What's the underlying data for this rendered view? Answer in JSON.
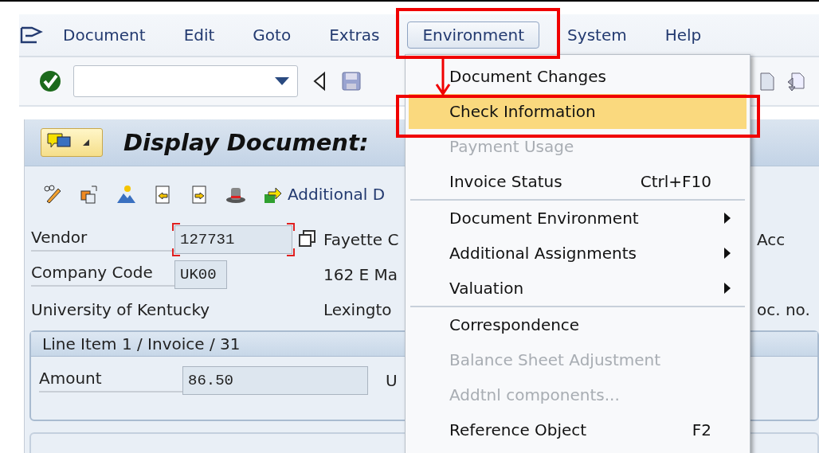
{
  "menu_bar": [
    {
      "label": "Document",
      "selected": false
    },
    {
      "label": "Edit",
      "selected": false
    },
    {
      "label": "Goto",
      "selected": false
    },
    {
      "label": "Extras",
      "selected": false
    },
    {
      "label": "Environment",
      "selected": true
    },
    {
      "label": "System",
      "selected": false
    },
    {
      "label": "Help",
      "selected": false
    }
  ],
  "title": "Display Document:",
  "app_toolbar": {
    "link": "Additional D"
  },
  "form": [
    {
      "kind": "field",
      "label": "Vendor",
      "value": "127731",
      "middle": "Fayette C",
      "right": "Acc"
    },
    {
      "kind": "field",
      "label": "Company Code",
      "value": "UK00",
      "middle": "162 E Ma"
    },
    {
      "kind": "text",
      "label": "University of Kentucky",
      "middle": "Lexingto",
      "right": "oc. no."
    }
  ],
  "line_item": {
    "title": "Line Item 1 / Invoice / 31",
    "label": "Amount",
    "value": "86.50",
    "unit": "U"
  },
  "dropdown": {
    "groups": [
      {
        "items": [
          {
            "label": "Document Changes",
            "selected": false,
            "disabled": false,
            "submenu": false
          },
          {
            "label": "Check Information",
            "selected": true,
            "disabled": false,
            "submenu": false
          },
          {
            "label": "Payment Usage",
            "selected": false,
            "disabled": true,
            "submenu": false
          },
          {
            "label": "Invoice Status",
            "shortcut": "Ctrl+F10",
            "selected": false,
            "disabled": false,
            "submenu": false
          }
        ]
      },
      {
        "items": [
          {
            "label": "Document Environment",
            "selected": false,
            "disabled": false,
            "submenu": true
          },
          {
            "label": "Additional Assignments",
            "selected": false,
            "disabled": false,
            "submenu": true
          },
          {
            "label": "Valuation",
            "selected": false,
            "disabled": false,
            "submenu": true
          }
        ]
      },
      {
        "items": [
          {
            "label": "Correspondence",
            "selected": false,
            "disabled": false,
            "submenu": false
          },
          {
            "label": "Balance Sheet Adjustment",
            "selected": false,
            "disabled": true,
            "submenu": false
          },
          {
            "label": "Addtnl components...",
            "selected": false,
            "disabled": true,
            "submenu": false
          },
          {
            "label": "Reference Object",
            "shortcut": "F2",
            "selected": false,
            "disabled": false,
            "submenu": false
          }
        ]
      }
    ]
  }
}
